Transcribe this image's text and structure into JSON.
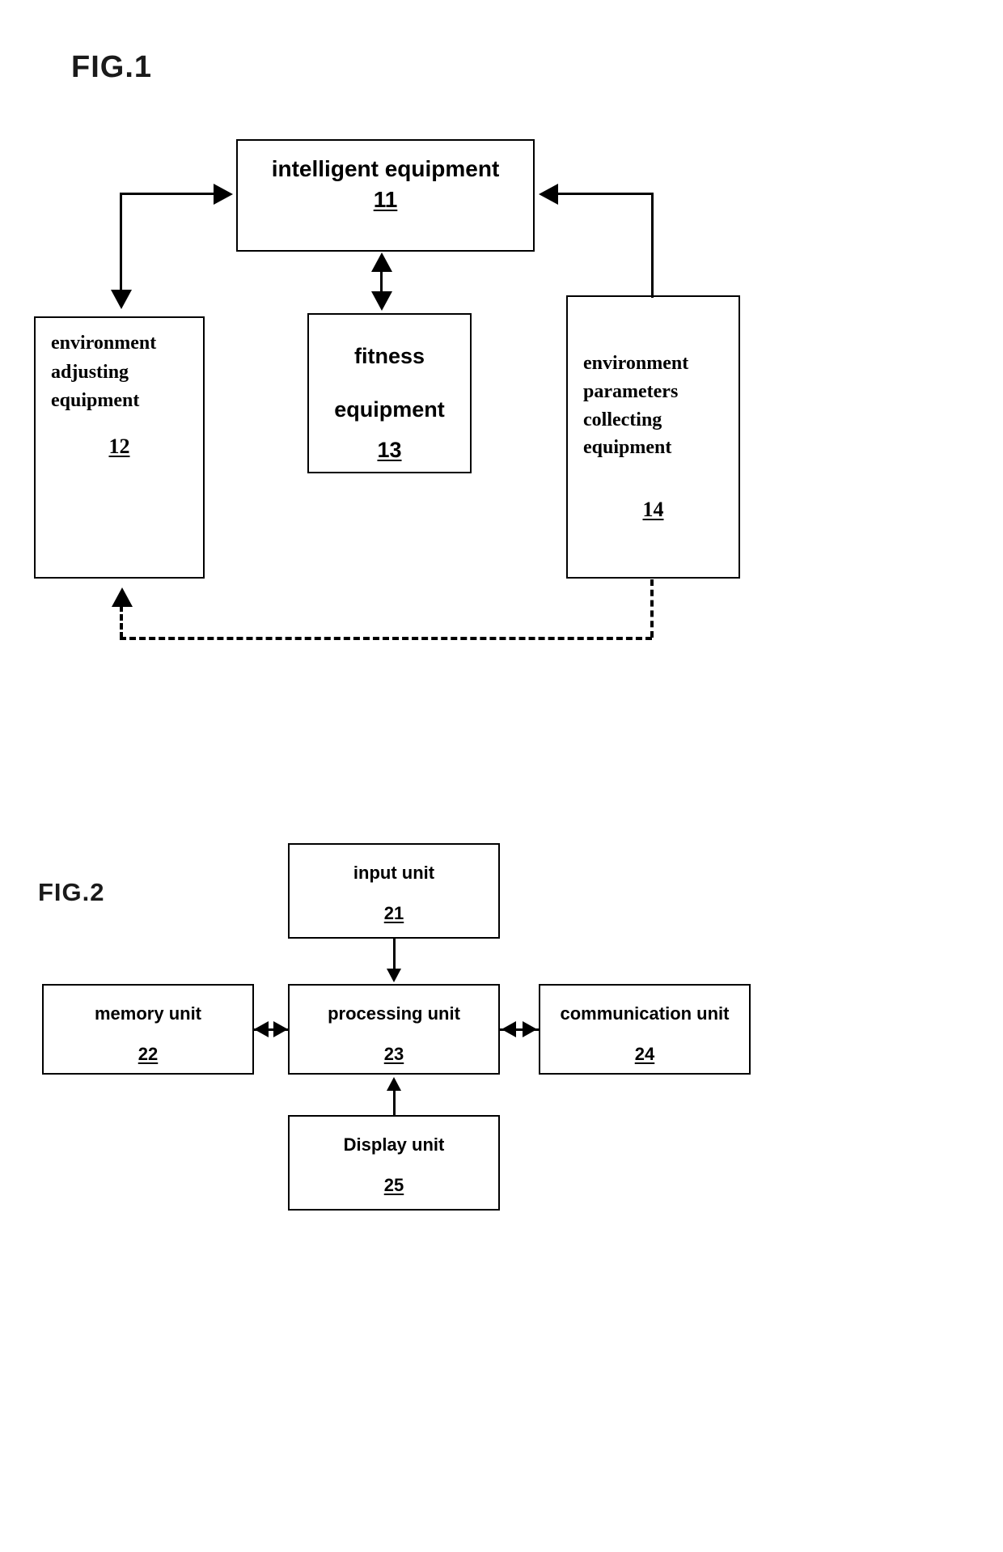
{
  "figures": {
    "fig1": {
      "label": "FIG.1",
      "boxes": {
        "intelligent_equipment": {
          "title": "intelligent equipment",
          "number": "11"
        },
        "environment_adjusting_equipment": {
          "title": "environment adjusting equipment",
          "number": "12"
        },
        "fitness_equipment": {
          "title": "fitness\nequipment",
          "number": "13"
        },
        "environment_parameters_collecting_equipment": {
          "title": "environment parameters collecting equipment",
          "number": "14"
        }
      },
      "connectors": [
        {
          "name": "intelligent-to-environment-adjusting",
          "style": "solid",
          "arrowheads": [
            "end"
          ],
          "from": "intelligent_equipment",
          "to": "environment_adjusting_equipment"
        },
        {
          "name": "environment-params-to-intelligent",
          "style": "solid",
          "arrowheads": [
            "end"
          ],
          "from": "environment_parameters_collecting_equipment",
          "to": "intelligent_equipment"
        },
        {
          "name": "intelligent-fitness-bidirectional",
          "style": "solid",
          "arrowheads": [
            "start",
            "end"
          ],
          "from": "intelligent_equipment",
          "to": "fitness_equipment"
        },
        {
          "name": "environment-params-to-environment-adjusting-feedback",
          "style": "dashed",
          "arrowheads": [
            "end"
          ],
          "from": "environment_parameters_collecting_equipment",
          "to": "environment_adjusting_equipment"
        }
      ]
    },
    "fig2": {
      "label": "FIG.2",
      "boxes": {
        "input_unit": {
          "title": "input unit",
          "number": "21"
        },
        "memory_unit": {
          "title": "memory unit",
          "number": "22"
        },
        "processing_unit": {
          "title": "processing unit",
          "number": "23"
        },
        "communication_unit": {
          "title": "communication unit",
          "number": "24"
        },
        "display_unit": {
          "title": "Display unit",
          "number": "25"
        }
      },
      "connectors": [
        {
          "name": "input-to-processing",
          "style": "solid",
          "arrowheads": [
            "end"
          ],
          "from": "input_unit",
          "to": "processing_unit"
        },
        {
          "name": "memory-processing-bidirectional",
          "style": "solid",
          "arrowheads": [
            "start",
            "end"
          ],
          "from": "memory_unit",
          "to": "processing_unit"
        },
        {
          "name": "processing-communication-bidirectional",
          "style": "solid",
          "arrowheads": [
            "start",
            "end"
          ],
          "from": "processing_unit",
          "to": "communication_unit"
        },
        {
          "name": "display-to-processing",
          "style": "solid",
          "arrowheads": [
            "end"
          ],
          "from": "display_unit",
          "to": "processing_unit"
        }
      ]
    }
  },
  "colors": {
    "ink": "#000000",
    "paper": "#ffffff"
  }
}
